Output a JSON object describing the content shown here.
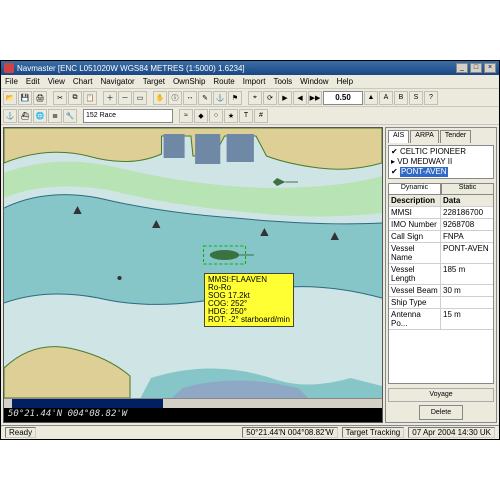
{
  "title": "Navmaster   [ENC  L051020W  WGS84  METRES  (1:5000)  1.6234]",
  "menu": [
    "File",
    "Edit",
    "View",
    "Chart",
    "Navigator",
    "Target",
    "OwnShip",
    "Route",
    "Import",
    "Tools",
    "Window",
    "Help"
  ],
  "toolbar": {
    "dropdown": "152 Race",
    "scale": "0.50"
  },
  "coords": "50°21.44'N 004°08.82'W",
  "tabs": {
    "t1": "AIS",
    "t2": "ARPA",
    "t3": "Tender"
  },
  "targets": {
    "items": [
      {
        "mark": "✔",
        "name": "CELTIC PIONEER"
      },
      {
        "mark": "▸",
        "name": "VD MEDWAY II"
      },
      {
        "mark": "✔",
        "name": "PONT-AVEN"
      }
    ]
  },
  "subtabs": {
    "t1": "Dynamic",
    "t2": "Static"
  },
  "grid": {
    "hdr": {
      "c1": "Description",
      "c2": "Data"
    },
    "rows": [
      {
        "c1": "MMSI",
        "c2": "228186700"
      },
      {
        "c1": "IMO Number",
        "c2": "9268708"
      },
      {
        "c1": "Call Sign",
        "c2": "FNPA"
      },
      {
        "c1": "Vessel Name",
        "c2": "PONT-AVEN"
      },
      {
        "c1": "Vessel Length",
        "c2": "185 m"
      },
      {
        "c1": "Vessel Beam",
        "c2": "30 m"
      },
      {
        "c1": "Ship Type",
        "c2": ""
      },
      {
        "c1": "Antenna Po...",
        "c2": "15 m"
      }
    ]
  },
  "voyage": "Voyage",
  "deleteLabel": "Delete",
  "tooltip": {
    "l1": "MMSI:FLAAVEN",
    "l2": "Ro-Ro",
    "l3": "SOG 17.2kt",
    "l4": "COG: 252°",
    "l5": "HDG: 250°",
    "l6": "ROT: -2° starboard/min"
  },
  "status": {
    "ready": "Ready",
    "pos": "50°21.44'N 004°08.82'W",
    "mode": "Target Tracking",
    "time": "07 Apr 2004   14:30 UK"
  }
}
